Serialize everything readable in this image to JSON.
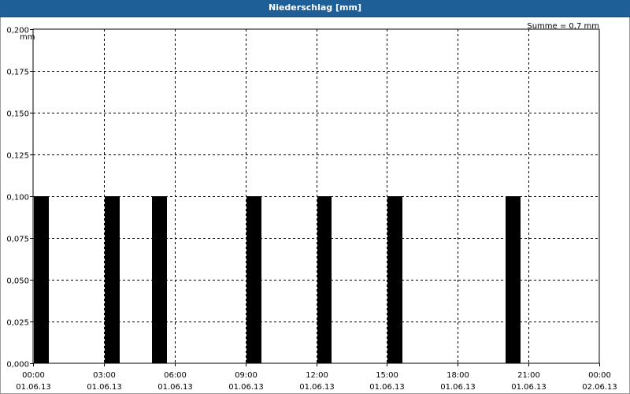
{
  "window": {
    "title": "Niederschlag [mm]"
  },
  "chart_data": {
    "type": "bar",
    "title": "Niederschlag [mm]",
    "ylabel": "mm",
    "summary": "Summe = 0,7 mm",
    "ylim": [
      0,
      0.2
    ],
    "y_ticks": [
      "0,000",
      "0,025",
      "0,050",
      "0,075",
      "0,100",
      "0,125",
      "0,150",
      "0,175",
      "0,200"
    ],
    "x_range_hours": [
      0,
      24
    ],
    "x_ticks": [
      {
        "time": "00:00",
        "date": "01.06.13"
      },
      {
        "time": "03:00",
        "date": "01.06.13"
      },
      {
        "time": "06:00",
        "date": "01.06.13"
      },
      {
        "time": "09:00",
        "date": "01.06.13"
      },
      {
        "time": "12:00",
        "date": "01.06.13"
      },
      {
        "time": "15:00",
        "date": "01.06.13"
      },
      {
        "time": "18:00",
        "date": "01.06.13"
      },
      {
        "time": "21:00",
        "date": "01.06.13"
      },
      {
        "time": "00:00",
        "date": "02.06.13"
      }
    ],
    "bars": [
      {
        "start_hour": 0.0,
        "end_hour": 0.667,
        "value": 0.1
      },
      {
        "start_hour": 3.0,
        "end_hour": 3.667,
        "value": 0.1
      },
      {
        "start_hour": 5.0,
        "end_hour": 5.667,
        "value": 0.1
      },
      {
        "start_hour": 9.0,
        "end_hour": 9.667,
        "value": 0.1
      },
      {
        "start_hour": 12.0,
        "end_hour": 12.667,
        "value": 0.1
      },
      {
        "start_hour": 15.0,
        "end_hour": 15.667,
        "value": 0.1
      },
      {
        "start_hour": 20.0,
        "end_hour": 20.667,
        "value": 0.1
      }
    ],
    "bar_color": "#000000",
    "grid": true
  }
}
